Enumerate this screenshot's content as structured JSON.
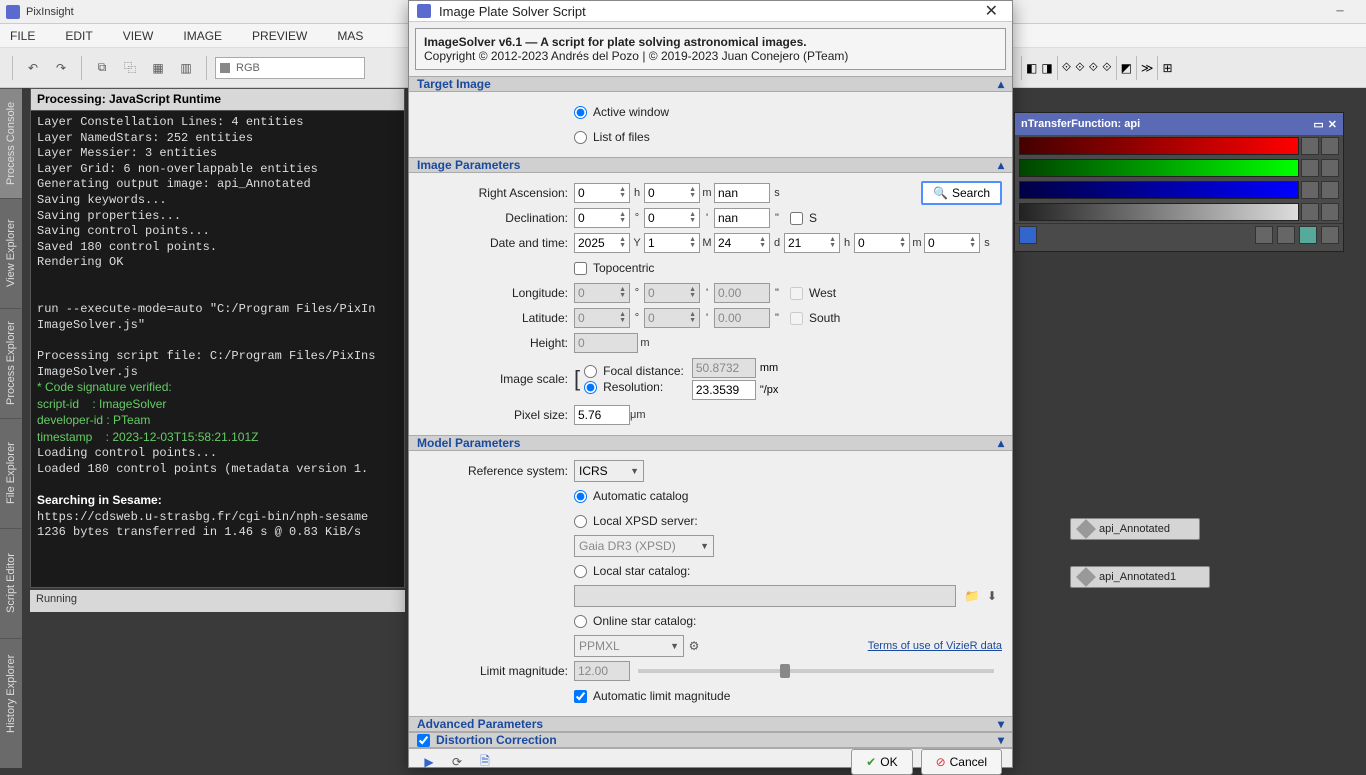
{
  "app": {
    "title": "PixInsight"
  },
  "menu": [
    "FILE",
    "EDIT",
    "VIEW",
    "IMAGE",
    "PREVIEW",
    "MAS"
  ],
  "toolbar": {
    "combo": "RGB"
  },
  "leftTabs": [
    "Process Console",
    "View Explorer",
    "Process Explorer",
    "File Explorer",
    "Script Editor",
    "History Explorer"
  ],
  "console": {
    "header": "Processing: JavaScript Runtime",
    "lines": [
      "Layer Constellation Lines: 4 entities",
      "Layer NamedStars: 252 entities",
      "Layer Messier: 3 entities",
      "Layer Grid: 6 non-overlappable entities",
      "Generating output image: api_Annotated",
      "Saving keywords...",
      "Saving properties...",
      "Saving control points...",
      "Saved 180 control points.",
      "Rendering OK",
      "",
      "",
      "run --execute-mode=auto \"C:/Program Files/PixIn",
      "ImageSolver.js\"",
      "",
      "Processing script file: C:/Program Files/PixIns",
      "ImageSolver.js"
    ],
    "greenLines": [
      "* Code signature verified:",
      "script-id    : ImageSolver",
      "developer-id : PTeam",
      "timestamp    : 2023-12-03T15:58:21.101Z"
    ],
    "afterGreen": [
      "Loading control points...",
      "Loaded 180 control points (metadata version 1."
    ],
    "sesame": {
      "title": "Searching in Sesame:",
      "url": "https://cdsweb.u-strasbg.fr/cgi-bin/nph-sesame",
      "bytes": "1236 bytes transferred in 1.46 s @ 0.83 KiB/s"
    },
    "footer": "Running"
  },
  "dialog": {
    "title": "Image Plate Solver Script",
    "info1": "ImageSolver v6.1 — A script for plate solving astronomical images.",
    "info2": "Copyright © 2012-2023 Andrés del Pozo | © 2019-2023 Juan Conejero (PTeam)",
    "sections": {
      "target": {
        "title": "Target Image",
        "activeWindow": "Active window",
        "listOfFiles": "List of files"
      },
      "imageParams": {
        "title": "Image Parameters",
        "ra": {
          "label": "Right Ascension:",
          "h": "0",
          "m": "0",
          "s": "nan"
        },
        "dec": {
          "label": "Declination:",
          "d": "0",
          "m": "0",
          "s": "nan",
          "south": "S"
        },
        "date": {
          "label": "Date and time:",
          "y": "2025",
          "mo": "1",
          "d": "24",
          "h": "21",
          "mi": "0",
          "s": "0"
        },
        "topo": "Topocentric",
        "lon": {
          "label": "Longitude:",
          "d": "0",
          "m": "0",
          "s": "0.00",
          "west": "West"
        },
        "lat": {
          "label": "Latitude:",
          "d": "0",
          "m": "0",
          "s": "0.00",
          "south": "South"
        },
        "height": {
          "label": "Height:",
          "v": "0",
          "u": "m"
        },
        "scale": {
          "label": "Image scale:",
          "focal": "Focal distance:",
          "focalV": "50.8732",
          "focalU": "mm",
          "res": "Resolution:",
          "resV": "23.3539",
          "resU": "\"/px"
        },
        "pixel": {
          "label": "Pixel size:",
          "v": "5.76",
          "u": "μm"
        },
        "search": "Search"
      },
      "model": {
        "title": "Model Parameters",
        "refSys": {
          "label": "Reference system:",
          "v": "ICRS"
        },
        "autoCat": "Automatic catalog",
        "localXPSD": "Local XPSD server:",
        "xpsdSel": "Gaia DR3 (XPSD)",
        "localStar": "Local star catalog:",
        "onlineStar": "Online star catalog:",
        "onlineSel": "PPMXL",
        "vizier": "Terms of use of VizieR data",
        "limitMag": {
          "label": "Limit magnitude:",
          "v": "12.00"
        },
        "autoLimit": "Automatic limit magnitude"
      },
      "advanced": {
        "title": "Advanced Parameters"
      },
      "distortion": {
        "title": "Distortion Correction"
      }
    },
    "buttons": {
      "ok": "OK",
      "cancel": "Cancel"
    }
  },
  "stf": {
    "title": "nTransferFunction: api"
  },
  "workspace": {
    "icon1": "api_Annotated",
    "icon2": "api_Annotated1"
  }
}
